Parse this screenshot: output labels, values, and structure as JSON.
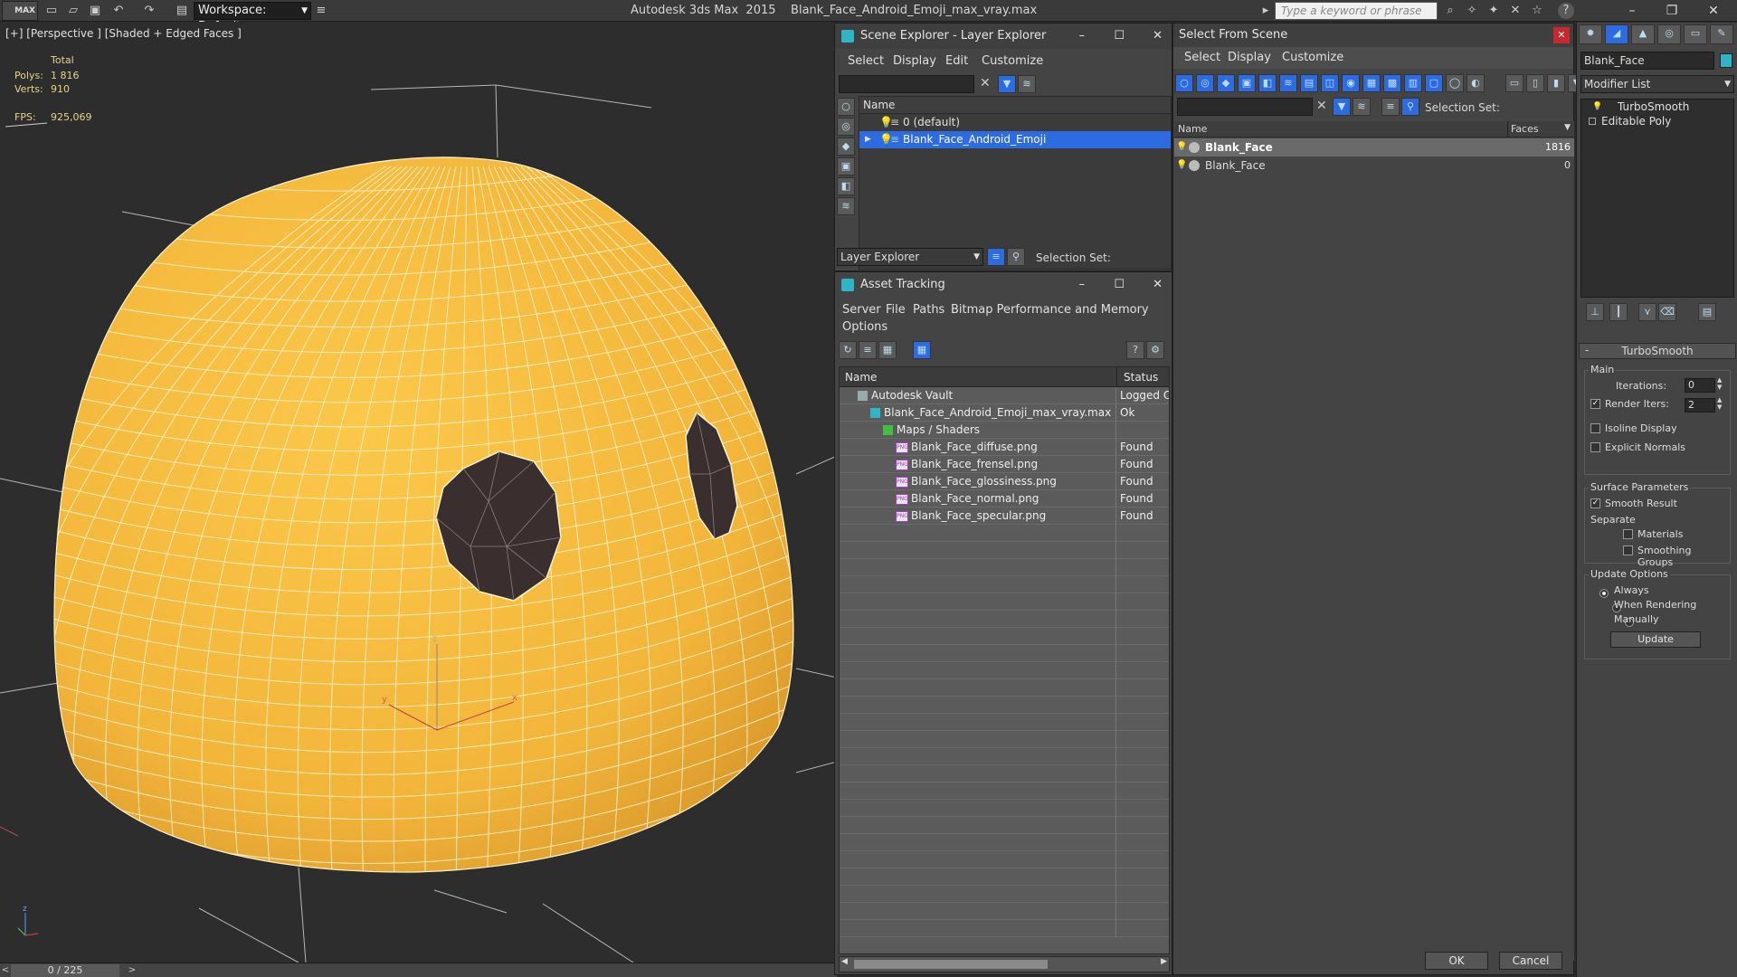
{
  "app": {
    "title": "Autodesk 3ds Max  2015    Blank_Face_Android_Emoji_max_vray.max",
    "logo_text": "MAX",
    "workspace": "Workspace: Default",
    "search_placeholder": "Type a keyword or phrase",
    "help_icon": "?"
  },
  "viewport": {
    "label": "[+] [Perspective ] [Shaded + Edged Faces ]",
    "stats": {
      "total_label": "Total",
      "polys_label": "Polys:",
      "polys_value": "1 816",
      "verts_label": "Verts:",
      "verts_value": "910",
      "fps_label": "FPS:",
      "fps_value": "925,069"
    },
    "axis": {
      "x": "x",
      "y": "y",
      "z": "z"
    },
    "colors": {
      "mesh": "#f2b93b",
      "wire": "#fff6d0",
      "eye": "#3a2e2e",
      "grid": "#cfcfcf"
    }
  },
  "timeline": {
    "frame": "0 / 225",
    "prev": "<",
    "next": ">"
  },
  "scene_explorer": {
    "title": "Scene Explorer - Layer Explorer",
    "menu": [
      "Select",
      "Display",
      "Edit",
      "Customize"
    ],
    "column_name": "Name",
    "rows": [
      {
        "label": "0 (default)",
        "selected": false
      },
      {
        "label": "Blank_Face_Android_Emoji",
        "selected": true
      }
    ],
    "explorer_select": "Layer Explorer",
    "selection_set_label": "Selection Set:"
  },
  "asset_tracking": {
    "title": "Asset Tracking",
    "menu": [
      "Server",
      "File",
      "Paths",
      "Bitmap Performance and Memory"
    ],
    "menu2": "Options",
    "col_name": "Name",
    "col_status": "Status",
    "rows": [
      {
        "indent": 1,
        "name": "Autodesk Vault",
        "status": "Logged Out",
        "icon": "vault-icon"
      },
      {
        "indent": 2,
        "name": "Blank_Face_Android_Emoji_max_vray.max",
        "status": "Ok",
        "icon": "max-file-icon"
      },
      {
        "indent": 3,
        "name": "Maps / Shaders",
        "status": "",
        "icon": "maps-icon"
      },
      {
        "indent": 4,
        "name": "Blank_Face_diffuse.png",
        "status": "Found",
        "icon": "png-icon"
      },
      {
        "indent": 4,
        "name": "Blank_Face_frensel.png",
        "status": "Found",
        "icon": "png-icon"
      },
      {
        "indent": 4,
        "name": "Blank_Face_glossiness.png",
        "status": "Found",
        "icon": "png-icon"
      },
      {
        "indent": 4,
        "name": "Blank_Face_normal.png",
        "status": "Found",
        "icon": "png-icon"
      },
      {
        "indent": 4,
        "name": "Blank_Face_specular.png",
        "status": "Found",
        "icon": "png-icon"
      }
    ],
    "png_badge": "PNG"
  },
  "select_from_scene": {
    "title": "Select From Scene",
    "menu": [
      "Select",
      "Display",
      "Customize"
    ],
    "selection_set_label": "Selection Set:",
    "col_name": "Name",
    "col_faces": "Faces",
    "rows": [
      {
        "name": "Blank_Face",
        "faces": "1816",
        "selected": true
      },
      {
        "name": "Blank_Face",
        "faces": "0",
        "selected": false
      }
    ],
    "ok": "OK",
    "cancel": "Cancel"
  },
  "command_panel": {
    "object_name": "Blank_Face",
    "object_color": "#30b4c8",
    "modifier_list": "Modifier List",
    "stack": [
      "TurboSmooth",
      "Editable Poly"
    ],
    "rollout_title": "TurboSmooth",
    "main_label": "Main",
    "iterations_label": "Iterations:",
    "iterations_value": "0",
    "render_iters_label": "Render Iters:",
    "render_iters_value": "2",
    "render_iters_checked": true,
    "isoline_label": "Isoline Display",
    "explicit_normals_label": "Explicit Normals",
    "surface_label": "Surface Parameters",
    "smooth_result_label": "Smooth Result",
    "separate_label": "Separate",
    "materials_label": "Materials",
    "smoothing_groups_label": "Smoothing Groups",
    "update_options_label": "Update Options",
    "always_label": "Always",
    "when_rendering_label": "When Rendering",
    "manually_label": "Manually",
    "update_button": "Update",
    "collapse": "-"
  }
}
